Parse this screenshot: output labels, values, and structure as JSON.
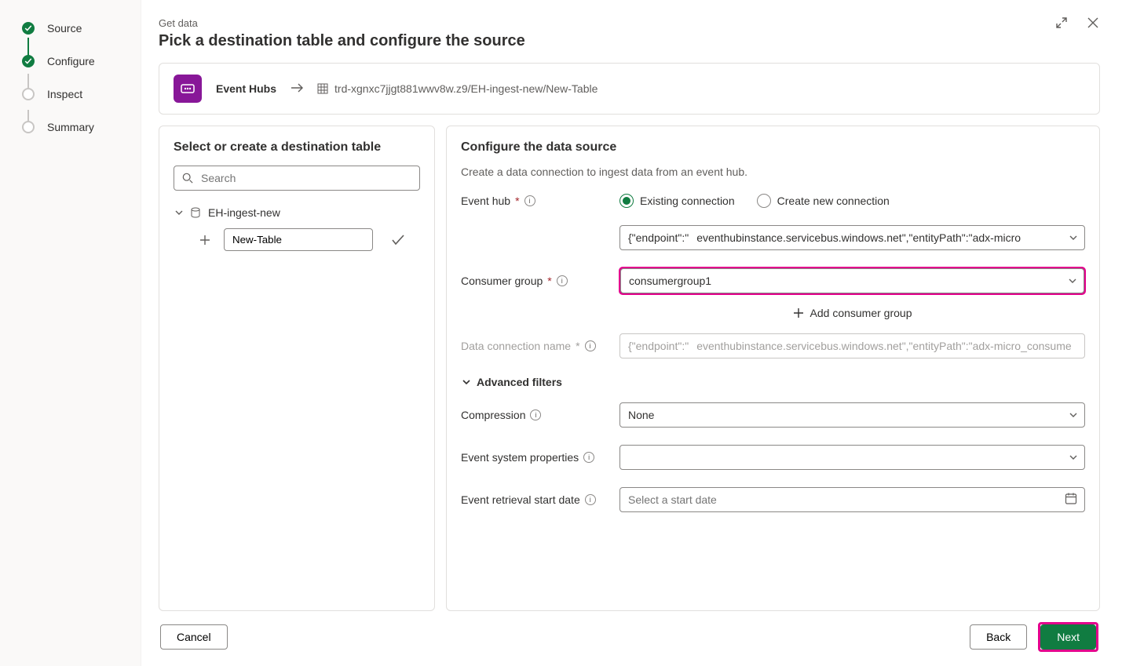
{
  "stepper": {
    "items": [
      {
        "label": "Source",
        "state": "done"
      },
      {
        "label": "Configure",
        "state": "done"
      },
      {
        "label": "Inspect",
        "state": "todo"
      },
      {
        "label": "Summary",
        "state": "todo"
      }
    ]
  },
  "header": {
    "crumb": "Get data",
    "title": "Pick a destination table and configure the source"
  },
  "pathbar": {
    "source_label": "Event Hubs",
    "path_text": "trd-xgnxc7jjgt881wwv8w.z9/EH-ingest-new/New-Table"
  },
  "left_panel": {
    "title": "Select or create a destination table",
    "search_placeholder": "Search",
    "db_name": "EH-ingest-new",
    "new_table_value": "New-Table"
  },
  "right_panel": {
    "title": "Configure the data source",
    "subtitle": "Create a data connection to ingest data from an event hub.",
    "labels": {
      "event_hub": "Event hub",
      "consumer_group": "Consumer group",
      "data_connection_name": "Data connection name",
      "advanced_filters": "Advanced filters",
      "compression": "Compression",
      "event_system_properties": "Event system properties",
      "event_retrieval_start_date": "Event retrieval start date"
    },
    "radios": {
      "existing": "Existing connection",
      "create_new": "Create new connection"
    },
    "values": {
      "event_hub_prefix": "{\"endpoint\":\"",
      "event_hub_value": "eventhubinstance.servicebus.windows.net\",\"entityPath\":\"adx-micro",
      "consumer_group": "consumergroup1",
      "add_consumer_group": "Add consumer group",
      "dcn_prefix": "{\"endpoint\":\"",
      "dcn_value": "eventhubinstance.servicebus.windows.net\",\"entityPath\":\"adx-micro_consume",
      "compression": "None",
      "event_system_properties": "",
      "start_date_placeholder": "Select a start date"
    }
  },
  "footer": {
    "cancel": "Cancel",
    "back": "Back",
    "next": "Next"
  }
}
